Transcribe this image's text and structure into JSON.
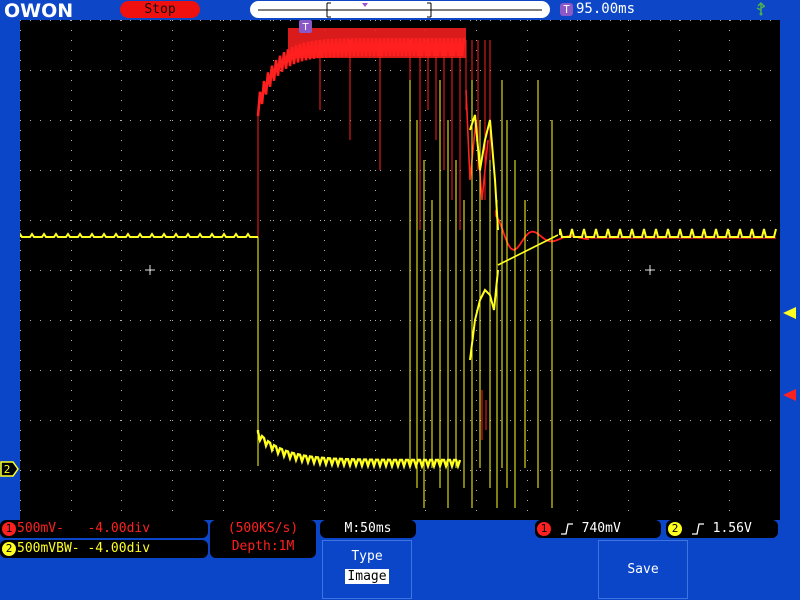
{
  "header": {
    "brand": "OWON",
    "run_status": "Stop",
    "trigger_position_badge": "T",
    "trigger_time": "95.00ms",
    "usb_icon": "usb-icon"
  },
  "colors": {
    "ch1": "#ff2020",
    "ch2": "#ffff20",
    "background": "#0b46c9",
    "screen": "#000000",
    "trigger_marker": "#8b58c7"
  },
  "channels": {
    "ch1": {
      "number": "1",
      "scale": "500mV-",
      "offset": "-4.00div"
    },
    "ch2": {
      "number": "2",
      "scale": "500mVBW-",
      "offset": "-4.00div"
    }
  },
  "acquisition": {
    "sample_rate": "(500KS/s)",
    "depth": "Depth:1M"
  },
  "timebase": {
    "label": "M:50ms"
  },
  "trigger": {
    "ch1": {
      "number": "1",
      "level": "740mV"
    },
    "ch2": {
      "number": "2",
      "level": "1.56V"
    }
  },
  "softkeys": {
    "type": {
      "label": "Type",
      "value": "Image"
    },
    "save": {
      "label": "Save"
    }
  },
  "side_markers": {
    "ch2_ground": "2"
  }
}
